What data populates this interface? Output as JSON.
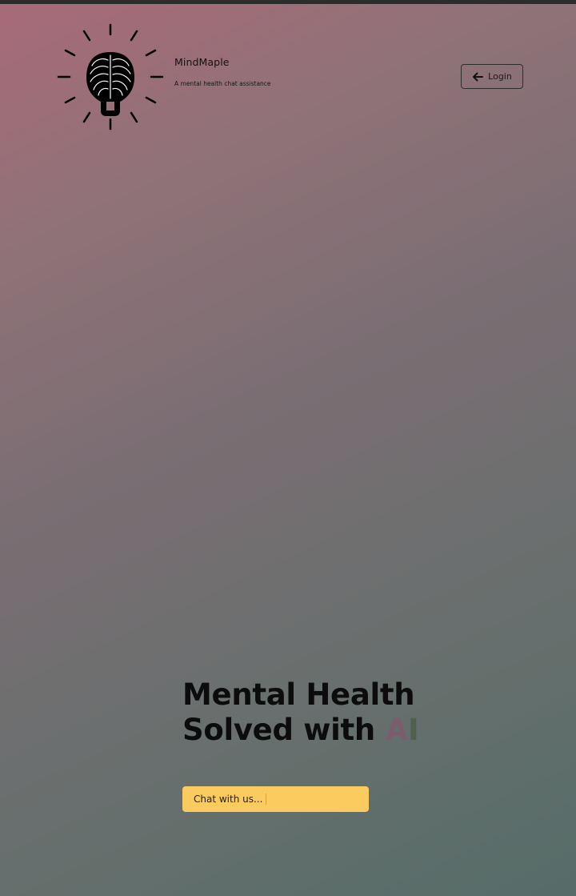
{
  "header": {
    "logo_icon": "brain-lightbulb-icon",
    "brand_name": "MindMaple",
    "tagline": "A mental health chat assistance",
    "login": {
      "label": "Login",
      "icon": "arrow-left-icon"
    }
  },
  "hero": {
    "line1": "Mental Health",
    "line2_prefix": "Solved with ",
    "line2_highlight_a": "A",
    "line2_highlight_b": "I"
  },
  "cta": {
    "label": "Chat with us..."
  },
  "colors": {
    "cta_background": "#fccb5f",
    "gradient_top": "#a86a78",
    "gradient_bottom": "#566c68",
    "ai_a": "#7b5e6d",
    "ai_i": "#50604f"
  }
}
